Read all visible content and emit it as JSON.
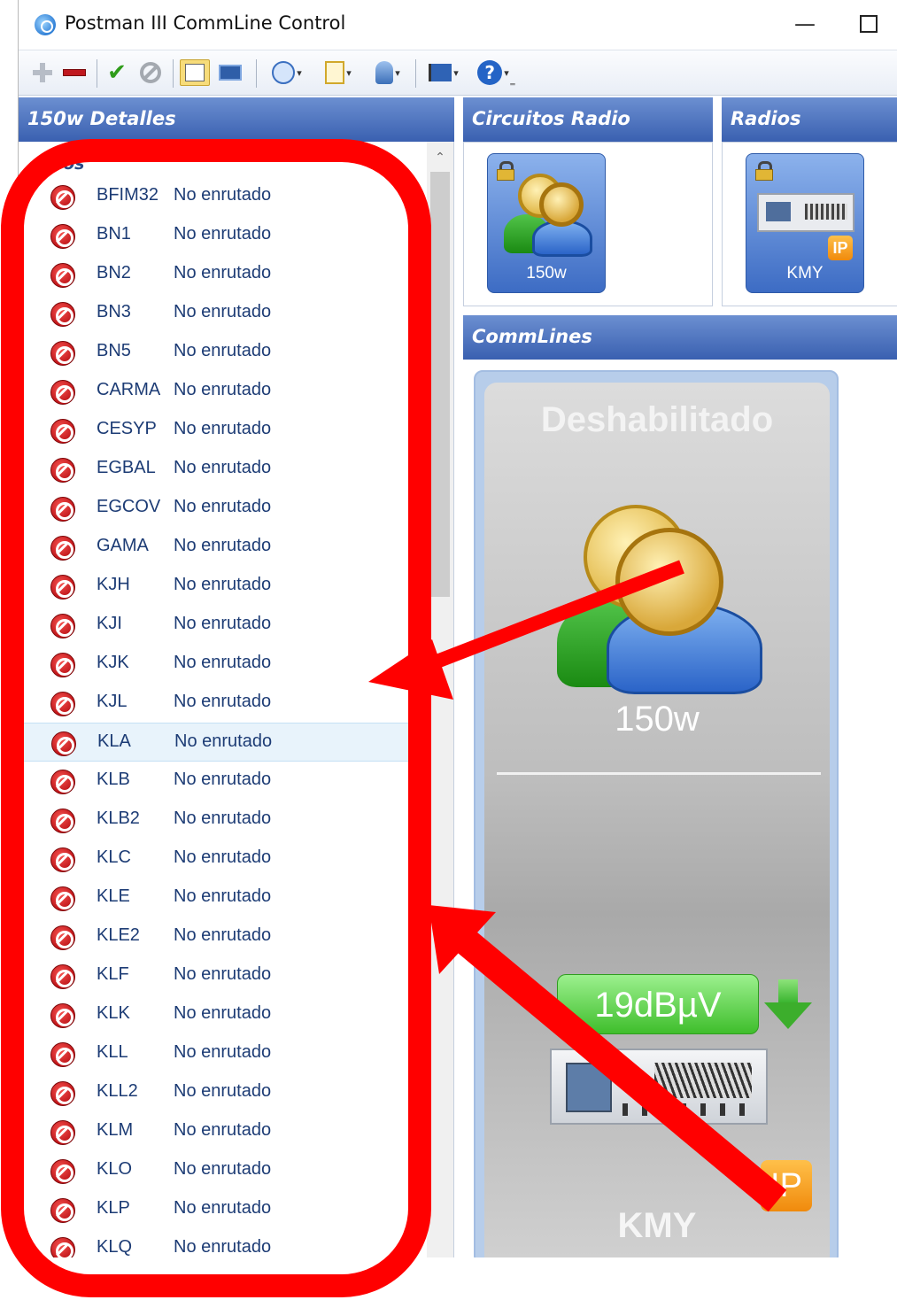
{
  "window": {
    "title": "Postman III CommLine Control",
    "minimize_glyph": "—"
  },
  "toolbar": {
    "icons": [
      "add-icon",
      "remove-icon",
      "check-icon",
      "cancel-icon",
      "properties-icon",
      "monitor-icon",
      "radio-icon",
      "document-icon",
      "user-icon",
      "flag-icon",
      "help-icon"
    ],
    "caret": "▾",
    "help_glyph": "?",
    "overflow": "⁼"
  },
  "panels": {
    "detalles_title": "150w Detalles",
    "circuitos_title": "Circuitos Radio",
    "radios_title": "Radios",
    "commlines_title": "CommLines"
  },
  "detalles": {
    "group_title": "dios",
    "rows": [
      {
        "code": "BFIM32",
        "status": "No enrutado"
      },
      {
        "code": "BN1",
        "status": "No enrutado"
      },
      {
        "code": "BN2",
        "status": "No enrutado"
      },
      {
        "code": "BN3",
        "status": "No enrutado"
      },
      {
        "code": "BN5",
        "status": "No enrutado"
      },
      {
        "code": "CARMA",
        "status": "No enrutado"
      },
      {
        "code": "CESYP",
        "status": "No enrutado"
      },
      {
        "code": "EGBAL",
        "status": "No enrutado"
      },
      {
        "code": "EGCOV",
        "status": "No enrutado"
      },
      {
        "code": "GAMA",
        "status": "No enrutado"
      },
      {
        "code": "KJH",
        "status": "No enrutado"
      },
      {
        "code": "KJI",
        "status": "No enrutado"
      },
      {
        "code": "KJK",
        "status": "No enrutado"
      },
      {
        "code": "KJL",
        "status": "No enrutado"
      },
      {
        "code": "KLA",
        "status": "No enrutado",
        "selected": true
      },
      {
        "code": "KLB",
        "status": "No enrutado"
      },
      {
        "code": "KLB2",
        "status": "No enrutado"
      },
      {
        "code": "KLC",
        "status": "No enrutado"
      },
      {
        "code": "KLE",
        "status": "No enrutado"
      },
      {
        "code": "KLE2",
        "status": "No enrutado"
      },
      {
        "code": "KLF",
        "status": "No enrutado"
      },
      {
        "code": "KLK",
        "status": "No enrutado"
      },
      {
        "code": "KLL",
        "status": "No enrutado"
      },
      {
        "code": "KLL2",
        "status": "No enrutado"
      },
      {
        "code": "KLM",
        "status": "No enrutado"
      },
      {
        "code": "KLO",
        "status": "No enrutado"
      },
      {
        "code": "KLP",
        "status": "No enrutado"
      },
      {
        "code": "KLQ",
        "status": "No enrutado"
      }
    ]
  },
  "circuitos": {
    "tile_label": "150w"
  },
  "radios": {
    "tile_label": "KMY",
    "ip_badge": "IP"
  },
  "commline": {
    "state": "Deshabilitado",
    "circuit": "150w",
    "signal": "19dBµV",
    "ip_badge": "IP",
    "radio": "KMY"
  },
  "annotations": {
    "color": "#ff0000"
  }
}
